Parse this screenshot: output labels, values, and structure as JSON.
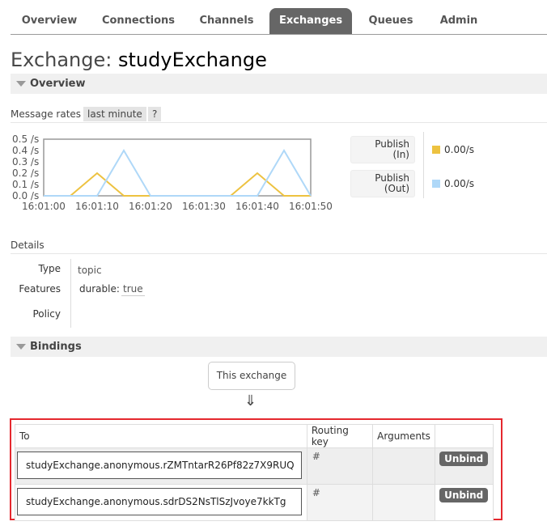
{
  "nav": {
    "tabs": [
      "Overview",
      "Connections",
      "Channels",
      "Exchanges",
      "Queues",
      "Admin"
    ],
    "active": "Exchanges"
  },
  "page": {
    "title_prefix": "Exchange:",
    "exchange_name": "studyExchange"
  },
  "sections": {
    "overview": "Overview",
    "bindings": "Bindings"
  },
  "rates": {
    "label": "Message rates",
    "range": "last minute",
    "help": "?"
  },
  "chart_data": {
    "type": "line",
    "x": [
      "16:01:00",
      "16:01:05",
      "16:01:10",
      "16:01:15",
      "16:01:20",
      "16:01:25",
      "16:01:30",
      "16:01:35",
      "16:01:40",
      "16:01:45",
      "16:01:50"
    ],
    "x_ticks": [
      "16:01:00",
      "16:01:10",
      "16:01:20",
      "16:01:30",
      "16:01:40",
      "16:01:50"
    ],
    "y_ticks": [
      "0.0 /s",
      "0.1 /s",
      "0.2 /s",
      "0.3 /s",
      "0.4 /s",
      "0.5 /s"
    ],
    "ylim": [
      0,
      0.5
    ],
    "series": [
      {
        "name": "Publish (In)",
        "color": "#edc240",
        "values": [
          0,
          0,
          0.2,
          0,
          0,
          0,
          0,
          0,
          0.2,
          0,
          0
        ]
      },
      {
        "name": "Publish (Out)",
        "color": "#afd8f8",
        "values": [
          0,
          0,
          0,
          0.4,
          0,
          0,
          0,
          0,
          0,
          0.4,
          0
        ]
      }
    ]
  },
  "legend": [
    {
      "label_line1": "Publish",
      "label_line2": "(In)",
      "value": "0.00/s",
      "color": "#edc240"
    },
    {
      "label_line1": "Publish",
      "label_line2": "(Out)",
      "value": "0.00/s",
      "color": "#afd8f8"
    }
  ],
  "details": {
    "title": "Details",
    "type_label": "Type",
    "type_value": "topic",
    "features_label": "Features",
    "features_key": "durable:",
    "features_value": "true",
    "policy_label": "Policy"
  },
  "bindings": {
    "source_label": "This exchange",
    "arrow": "⇓",
    "headers": {
      "to": "To",
      "routing_key": "Routing key",
      "arguments": "Arguments"
    },
    "rows": [
      {
        "destination": "studyExchange.anonymous.rZMTntarR26Pf82z7X9RUQ",
        "routing_key": "#",
        "unbind": "Unbind"
      },
      {
        "destination": "studyExchange.anonymous.sdrDS2NsTlSzJvoye7kkTg",
        "routing_key": "#",
        "unbind": "Unbind"
      }
    ]
  }
}
